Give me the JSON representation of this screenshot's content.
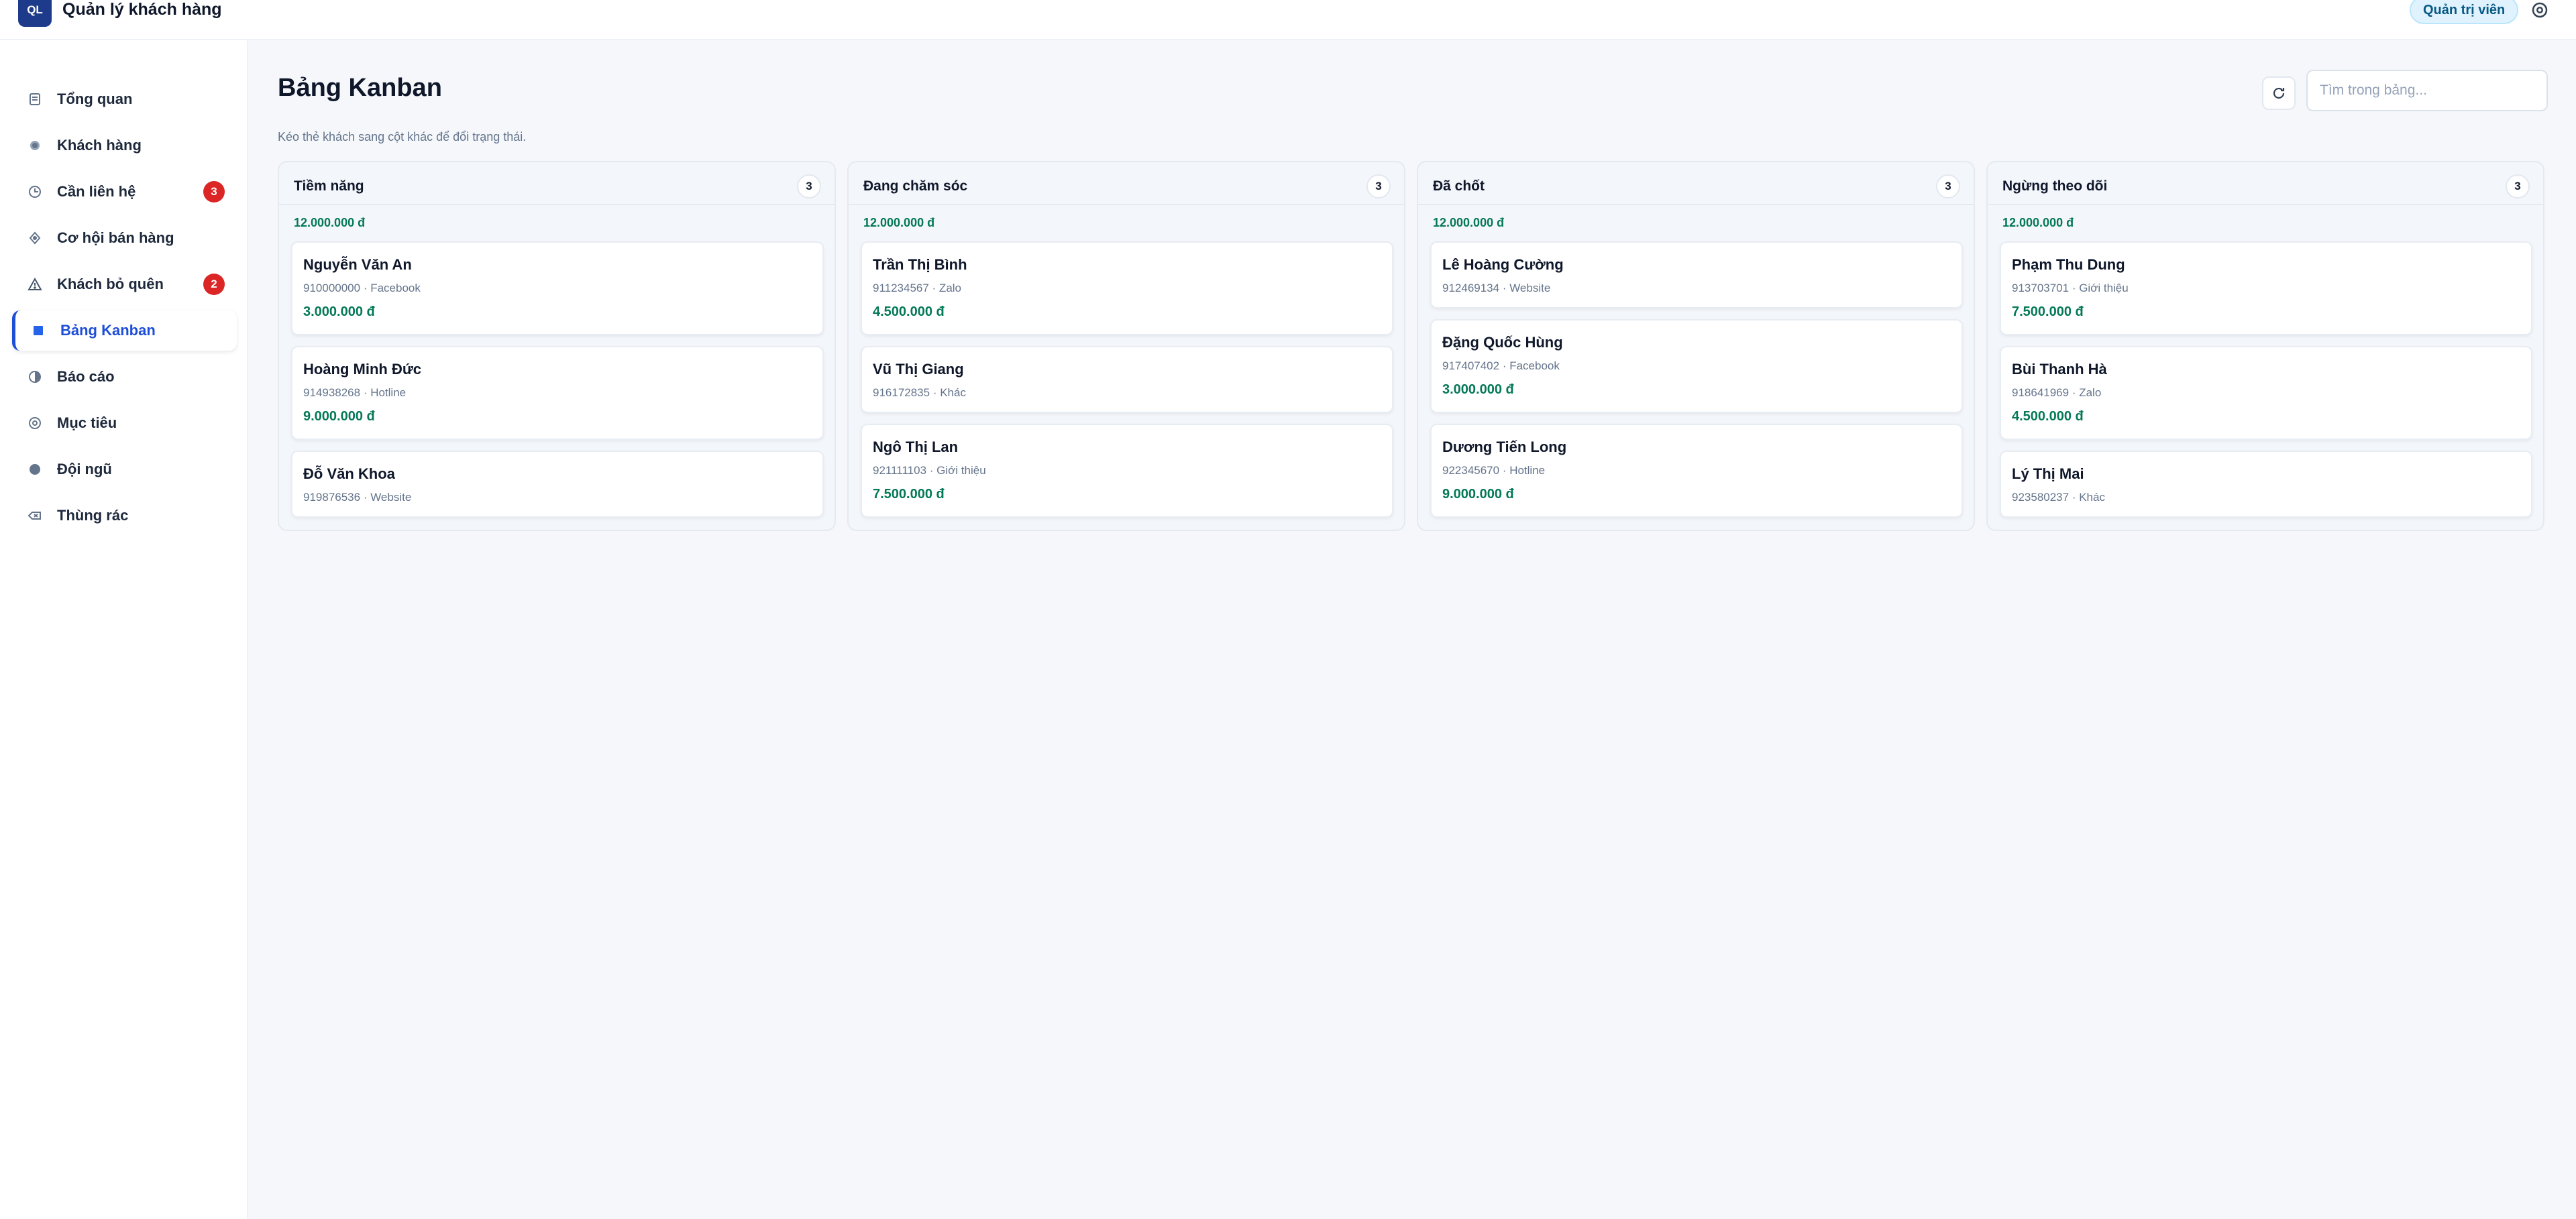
{
  "app": {
    "logo_text": "QL",
    "title": "Quản lý khách hàng",
    "role": "Quản trị viên",
    "settings_icon": "gear-icon"
  },
  "sidebar": {
    "items": [
      {
        "label": "Tổng quan",
        "icon": "list-icon"
      },
      {
        "label": "Khách hàng",
        "icon": "users-icon"
      },
      {
        "label": "Cần liên hệ",
        "icon": "clock-icon",
        "badge": "3"
      },
      {
        "label": "Cơ hội bán hàng",
        "icon": "diamond-icon"
      },
      {
        "label": "Khách bỏ quên",
        "icon": "warning-icon",
        "badge": "2"
      },
      {
        "label": "Bảng Kanban",
        "icon": "kanban-icon",
        "active": true
      },
      {
        "label": "Báo cáo",
        "icon": "chart-icon"
      },
      {
        "label": "Mục tiêu",
        "icon": "target-icon"
      },
      {
        "label": "Đội ngũ",
        "icon": "team-icon"
      },
      {
        "label": "Thùng rác",
        "icon": "trash-icon"
      }
    ]
  },
  "main": {
    "title": "Bảng Kanban",
    "subtitle": "Kéo thẻ khách sang cột khác để đổi trạng thái.",
    "search_placeholder": "Tìm trong bảng...",
    "refresh_icon": "refresh-icon"
  },
  "columns": [
    {
      "title": "Tiềm năng",
      "count": "3",
      "total": "12.000.000 đ",
      "cards": [
        {
          "name": "Nguyễn Văn An",
          "meta": "910000000 · Facebook",
          "value": "3.000.000 đ"
        },
        {
          "name": "Hoàng Minh Đức",
          "meta": "914938268 · Hotline",
          "value": "9.000.000 đ"
        },
        {
          "name": "Đỗ Văn Khoa",
          "meta": "919876536 · Website",
          "value": ""
        }
      ]
    },
    {
      "title": "Đang chăm sóc",
      "count": "3",
      "total": "12.000.000 đ",
      "cards": [
        {
          "name": "Trần Thị Bình",
          "meta": "911234567 · Zalo",
          "value": "4.500.000 đ"
        },
        {
          "name": "Vũ Thị Giang",
          "meta": "916172835 · Khác",
          "value": ""
        },
        {
          "name": "Ngô Thị Lan",
          "meta": "921111103 · Giới thiệu",
          "value": "7.500.000 đ"
        }
      ]
    },
    {
      "title": "Đã chốt",
      "count": "3",
      "total": "12.000.000 đ",
      "cards": [
        {
          "name": "Lê Hoàng Cường",
          "meta": "912469134 · Website",
          "value": ""
        },
        {
          "name": "Đặng Quốc Hùng",
          "meta": "917407402 · Facebook",
          "value": "3.000.000 đ"
        },
        {
          "name": "Dương Tiến Long",
          "meta": "922345670 · Hotline",
          "value": "9.000.000 đ"
        }
      ]
    },
    {
      "title": "Ngừng theo dõi",
      "count": "3",
      "total": "12.000.000 đ",
      "cards": [
        {
          "name": "Phạm Thu Dung",
          "meta": "913703701 · Giới thiệu",
          "value": "7.500.000 đ"
        },
        {
          "name": "Bùi Thanh Hà",
          "meta": "918641969 · Zalo",
          "value": "4.500.000 đ"
        },
        {
          "name": "Lý Thị Mai",
          "meta": "923580237 · Khác",
          "value": ""
        }
      ]
    }
  ],
  "colors": {
    "accent": "#1d4ed8",
    "money": "#047857",
    "badge": "#dc2626"
  }
}
